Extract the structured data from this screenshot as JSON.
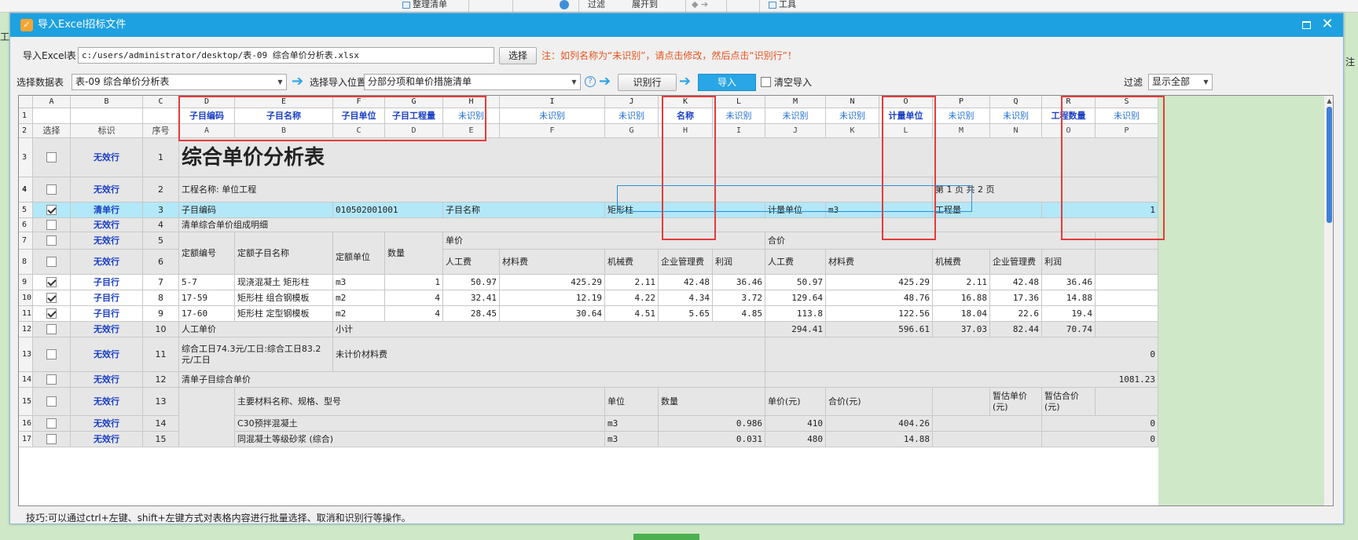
{
  "top_toolbar": {
    "items": [
      "整理清单",
      "过滤",
      "展开到",
      "工具"
    ]
  },
  "side_fragments": {
    "left": "工",
    "right": "注"
  },
  "dialog": {
    "title": "导入Excel招标文件",
    "file_label": "导入Excel表",
    "file_path": "c:/users/administrator/desktop/表-09 综合单价分析表.xlsx",
    "choose_button": "选择",
    "note": "注：如列名称为“未识别”，请点击修改，然后点击“识别行”！",
    "datasheet_label": "选择数据表",
    "datasheet_value": "表-09 综合单价分析表",
    "position_label": "选择导入位置",
    "position_value": "分部分项和单价措施清单",
    "help_icon": "?",
    "identify_button": "识别行",
    "import_button": "导入",
    "clear_import_label": "清空导入",
    "filter_label": "过滤",
    "filter_value": "显示全部",
    "tip": "技巧:可以通过ctrl+左键、shift+左键方式对表格内容进行批量选择、取消和识别行等操作。"
  },
  "grid": {
    "column_letters": [
      "A",
      "B",
      "C",
      "D",
      "E",
      "F",
      "G",
      "H",
      "I",
      "J",
      "K",
      "L",
      "M",
      "N",
      "O",
      "P",
      "Q",
      "R",
      "S"
    ],
    "row1_mappings": [
      "",
      "",
      "",
      "子目编码",
      "子目名称",
      "子目单位",
      "子目工程量",
      "未识别",
      "未识别",
      "未识别",
      "名称",
      "未识别",
      "未识别",
      "未识别",
      "计量单位",
      "未识别",
      "未识别",
      "工程数量",
      "未识别"
    ],
    "row2_labels": [
      "选择",
      "标识",
      "序号",
      "A",
      "B",
      "C",
      "D",
      "E",
      "F",
      "G",
      "H",
      "I",
      "J",
      "K",
      "L",
      "M",
      "N",
      "O",
      "P"
    ],
    "row_tags": {
      "invalid": "无效行",
      "list": "清单行",
      "sub": "子目行"
    },
    "r3": {
      "seq": "1",
      "title": "综合单价分析表"
    },
    "r4": {
      "seq": "2",
      "project": "工程名称: 单位工程",
      "page": "第 1 页  共 2 页"
    },
    "r5": {
      "seq": "3",
      "code_label": "子目编码",
      "code": "010502001001",
      "name_label": "子目名称",
      "name": "矩形柱",
      "unit_label": "计量单位",
      "unit": "m3",
      "qty_label": "工程量",
      "qty": "1"
    },
    "r6": {
      "seq": "4",
      "text": "清单综合单价组成明细"
    },
    "r7": {
      "seq": "5",
      "unit_price": "单价",
      "total_price": "合价"
    },
    "r8": {
      "seq": "6",
      "quota_code": "定额编号",
      "quota_name": "定额子目名称",
      "quota_unit": "定额单位",
      "qty": "数量",
      "labor": "人工费",
      "material": "材料费",
      "machine": "机械费",
      "mgmt": "企业管理费",
      "profit": "利润",
      "labor2": "人工费",
      "material2": "材料费",
      "machine2": "机械费",
      "mgmt2": "企业管理费",
      "profit2": "利润"
    },
    "sub_rows": [
      {
        "row": "9",
        "seq": "7",
        "code": "5-7",
        "name": "现浇混凝土 矩形柱",
        "unit": "m3",
        "qty": "1",
        "u_labor": "50.97",
        "u_material": "425.29",
        "u_machine": "2.11",
        "u_mgmt": "42.48",
        "u_profit": "36.46",
        "t_labor": "50.97",
        "t_material": "425.29",
        "t_machine": "2.11",
        "t_mgmt": "42.48",
        "t_profit": "36.46"
      },
      {
        "row": "10",
        "seq": "8",
        "code": "17-59",
        "name": "矩形柱 组合钢模板",
        "unit": "m2",
        "qty": "4",
        "u_labor": "32.41",
        "u_material": "12.19",
        "u_machine": "4.22",
        "u_mgmt": "4.34",
        "u_profit": "3.72",
        "t_labor": "129.64",
        "t_material": "48.76",
        "t_machine": "16.88",
        "t_mgmt": "17.36",
        "t_profit": "14.88"
      },
      {
        "row": "11",
        "seq": "9",
        "code": "17-60",
        "name": "矩形柱 定型钢模板",
        "unit": "m2",
        "qty": "4",
        "u_labor": "28.45",
        "u_material": "30.64",
        "u_machine": "4.51",
        "u_mgmt": "5.65",
        "u_profit": "4.85",
        "t_labor": "113.8",
        "t_material": "122.56",
        "t_machine": "18.04",
        "t_mgmt": "22.6",
        "t_profit": "19.4"
      }
    ],
    "r12": {
      "seq": "10",
      "labor_unit": "人工单价",
      "subtotal": "小计",
      "t_labor": "294.41",
      "t_material": "596.61",
      "t_machine": "37.03",
      "t_mgmt": "82.44",
      "t_profit": "70.74"
    },
    "r13": {
      "seq": "11",
      "text": "综合工日74.3元/工日:综合工日83.2元/工日",
      "label": "未计价材料费",
      "value": "0"
    },
    "r14": {
      "seq": "12",
      "text": "清单子目综合单价",
      "value": "1081.23"
    },
    "r15": {
      "seq": "13",
      "material_name": "主要材料名称、规格、型号",
      "unit": "单位",
      "qty": "数量",
      "unit_price": "单价(元)",
      "total": "合价(元)",
      "est_unit": "暂估单价(元)",
      "est_total": "暂估合价(元)"
    },
    "r16": {
      "seq": "14",
      "name": "C30预拌混凝土",
      "unit": "m3",
      "qty": "0.986",
      "unit_price": "410",
      "total": "404.26",
      "est_total": "0"
    },
    "r17": {
      "seq": "15",
      "name": "同混凝土等级砂浆 (综合)",
      "unit": "m3",
      "qty": "0.031",
      "unit_price": "480",
      "total": "14.88",
      "est_total": "0"
    }
  }
}
